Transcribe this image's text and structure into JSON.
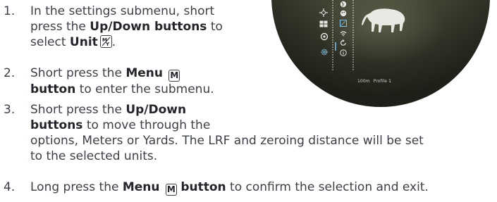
{
  "steps": [
    {
      "number": "1.",
      "lines": [
        [
          "In the settings submenu, short"
        ],
        [
          "press the ",
          {
            "b": "Up/Down buttons"
          },
          " to"
        ],
        [
          "select ",
          {
            "b": "Unit"
          }
        ]
      ],
      "icon": "unit-meters-yards-icon"
    },
    {
      "number": "2.",
      "lines": [
        [
          "Short press the ",
          {
            "b": "Menu"
          }
        ],
        [
          {
            "b": "button"
          },
          " to enter the submenu."
        ]
      ],
      "icon": "menu-key-icon",
      "key_label": "M"
    },
    {
      "number": "3.",
      "lines": [
        [
          "Short press the ",
          {
            "b": "Up/Down"
          }
        ],
        [
          {
            "b": "buttons"
          },
          " to move through the"
        ],
        [
          "options, Meters or Yards. The LRF and zeroing distance will be set"
        ],
        [
          "to the selected units."
        ]
      ]
    },
    {
      "number": "4.",
      "lines": [
        [
          "Long press the ",
          {
            "b": "Menu"
          },
          " ",
          {
            "b": "button"
          },
          " to confirm the selection and exit."
        ]
      ],
      "icon": "menu-key-icon",
      "key_label": "M"
    }
  ],
  "scope": {
    "status_distance": "100m",
    "status_profile": "Profile 1",
    "left_icons": [
      "crosshair-icon",
      "grid-icon",
      "target-icon",
      "settings-gear-icon"
    ],
    "right_icons": [
      "globe-icon",
      "palette-icon",
      "unit-icon",
      "wifi-icon",
      "reset-icon",
      "info-icon"
    ],
    "colors": {
      "active": "#7fc3e8",
      "icon": "#e6e6e6",
      "text": "#3c3f47",
      "bold": "#23252b"
    }
  }
}
